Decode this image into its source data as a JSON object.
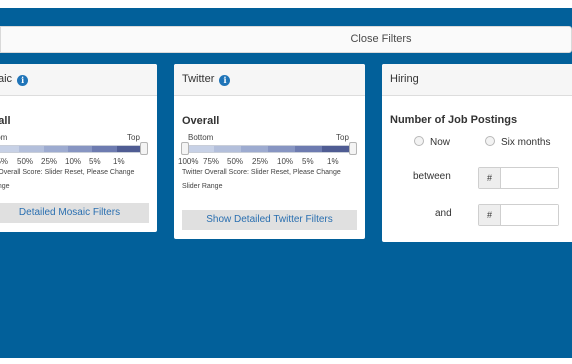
{
  "close_filters": {
    "label": "Close Filters"
  },
  "mosaic": {
    "title": "aic",
    "section": "rall",
    "bottom_label": "tom",
    "top_label": "Top",
    "ticks": [
      "75%",
      "50%",
      "25%",
      "10%",
      "5%",
      "1%"
    ],
    "note_line1": "r Overall Score: Slider Reset, Please Change",
    "note_line2": "ange",
    "button": "Detailed Mosaic Filters"
  },
  "twitter": {
    "title": "Twitter",
    "section": "Overall",
    "bottom_label": "Bottom",
    "top_label": "Top",
    "ticks": [
      "100%",
      "75%",
      "50%",
      "25%",
      "10%",
      "5%",
      "1%"
    ],
    "note_line1": "Twitter Overall Score: Slider Reset, Please Change",
    "note_line2": "Slider Range",
    "button": "Show Detailed Twitter Filters"
  },
  "hiring": {
    "title": "Hiring",
    "section": "Number of Job Postings",
    "radio_now": "Now",
    "radio_six": "Six months",
    "between_label": "between",
    "and_label": "and",
    "addon": "#"
  },
  "colors": {
    "background": "#02609a",
    "slider_segments": [
      "#c7d1e6",
      "#b3bfdb",
      "#9dabd0",
      "#8795c2",
      "#6d7bb0",
      "#4f5c93"
    ]
  }
}
